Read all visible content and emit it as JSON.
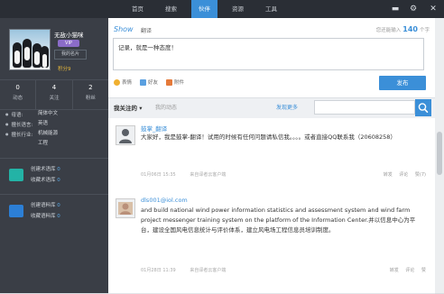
{
  "nav": {
    "items": [
      "首页",
      "搜索",
      "伙伴",
      "资源",
      "工具"
    ],
    "active_index": 2
  },
  "window_icons": {
    "minimize": "minimize-icon",
    "settings": "gear-icon",
    "close": "close-icon"
  },
  "profile": {
    "name": "无敌小猫咪",
    "vip": "VIP",
    "badge": "我的名片",
    "points": "积分9",
    "stats": [
      {
        "num": "0",
        "label": "动态"
      },
      {
        "num": "4",
        "label": "关注"
      },
      {
        "num": "2",
        "label": "粉丝"
      }
    ],
    "info": [
      {
        "key": "母语:",
        "val": "简体中文"
      },
      {
        "key": "擅长语言:",
        "val": "英语"
      },
      {
        "key": "擅长行业:",
        "val": "机械能源"
      },
      {
        "key": "",
        "val": "工程"
      }
    ]
  },
  "libraries": [
    {
      "create": "创建术语库",
      "create_count": "0",
      "collect": "收藏术语库",
      "collect_count": "0",
      "color": "#23b3a6"
    },
    {
      "create": "创建语料库",
      "create_count": "0",
      "collect": "收藏语料库",
      "collect_count": "0",
      "color": "#2c7fd6"
    }
  ],
  "compose": {
    "brand": "Show",
    "brand_sub": "翻译",
    "counter_prefix": "您还能输入",
    "counter_num": "140",
    "counter_suffix": "个字",
    "text": "记录，就是一种态度！",
    "tools": [
      {
        "label": "表情",
        "icon": "emoji-icon",
        "color": "#f0b030"
      },
      {
        "label": "好友",
        "icon": "friend-icon",
        "color": "#5aa0e0"
      },
      {
        "label": "附件",
        "icon": "attachment-icon",
        "color": "#e57a3a"
      }
    ],
    "post_button": "发布"
  },
  "filter": {
    "selected": "我关注的",
    "dynamic": "我的动态",
    "more": "发现更多",
    "search_placeholder": ""
  },
  "posts": [
    {
      "author": "鼓掌_翻译",
      "text": "大家好，我是鼓掌-翻译！试用的时候有任何问题请私信我。。。。或者直接QQ联系我（20608258）",
      "time": "01月06日 15:35",
      "source": "来自译者云客户端",
      "actions": [
        "转发",
        "评论",
        "赞(7)"
      ]
    },
    {
      "author": "dls001@iol.com",
      "text": "and build national wind power information statistics and assessment system and wind farm project messenger training system on the platform of the Information Center.并以信息中心为平台，建设全国风电信息统计与评价体系，建立风电场工程信息员培训制度。",
      "time": "01月28日 11:39",
      "source": "来自译者云客户端",
      "actions": [
        "转发",
        "评论",
        "赞"
      ]
    }
  ]
}
